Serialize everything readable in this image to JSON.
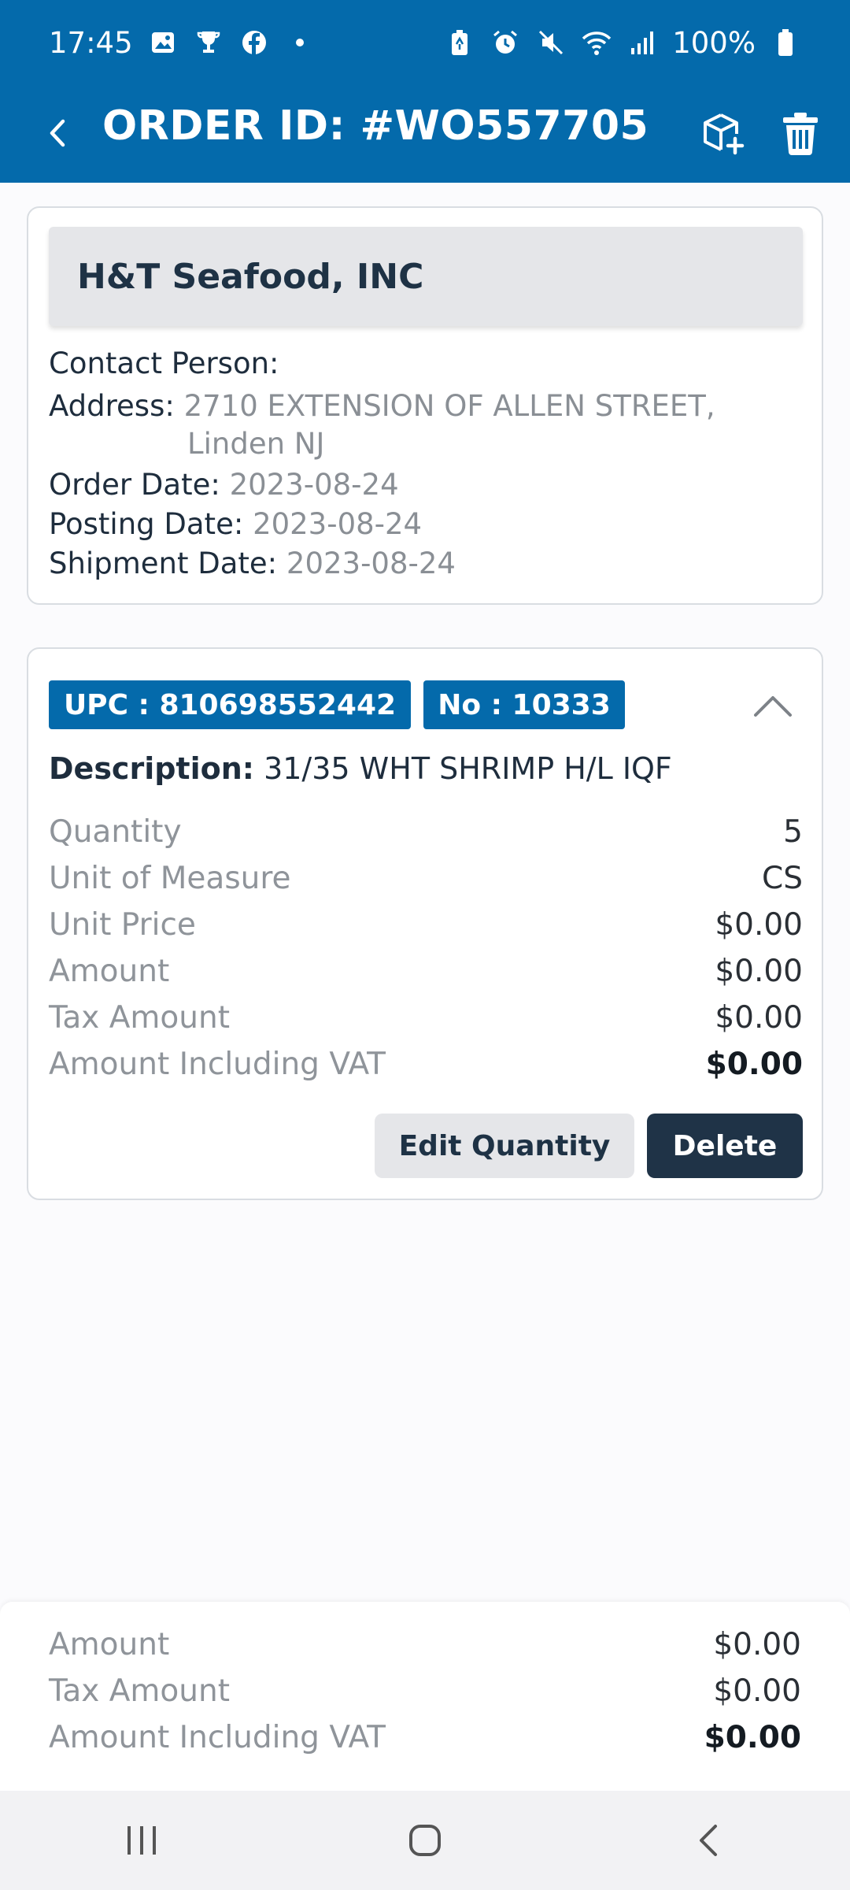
{
  "status_bar": {
    "time": "17:45",
    "battery": "100%",
    "left_icons": [
      "gallery-icon",
      "trophy-icon",
      "facebook-icon",
      "dot-icon"
    ],
    "right_icons": [
      "battery-saver-icon",
      "alarm-icon",
      "mute-icon",
      "wifi-icon",
      "signal-icon",
      "battery-icon"
    ]
  },
  "app_bar": {
    "title": "ORDER ID: #WO557705",
    "back_icon": "chevron-left-icon",
    "actions": [
      "add-box-icon",
      "trash-icon"
    ]
  },
  "order": {
    "company": "H&T Seafood, INC",
    "contact_label": "Contact Person:",
    "contact_value": "",
    "address_label": "Address:",
    "address_line1": "2710 EXTENSION OF ALLEN STREET,",
    "address_line2": "Linden NJ",
    "order_date_label": "Order Date:",
    "order_date": "2023-08-24",
    "posting_date_label": "Posting Date:",
    "posting_date": "2023-08-24",
    "shipment_date_label": "Shipment Date:",
    "shipment_date": "2023-08-24"
  },
  "line_item": {
    "upc_label": "UPC : 810698552442",
    "no_label": "No : 10333",
    "description_label": "Description:",
    "description": "31/35 WHT SHRIMP H/L IQF",
    "rows": [
      {
        "label": "Quantity",
        "value": "5"
      },
      {
        "label": "Unit of Measure",
        "value": "CS"
      },
      {
        "label": "Unit Price",
        "value": "$0.00"
      },
      {
        "label": "Amount",
        "value": "$0.00"
      },
      {
        "label": "Tax Amount",
        "value": "$0.00"
      },
      {
        "label": "Amount Including VAT",
        "value": "$0.00"
      }
    ],
    "edit_label": "Edit Quantity",
    "delete_label": "Delete"
  },
  "summary": {
    "rows": [
      {
        "label": "Amount",
        "value": "$0.00"
      },
      {
        "label": "Tax Amount",
        "value": "$0.00"
      },
      {
        "label": "Amount Including VAT",
        "value": "$0.00"
      }
    ]
  },
  "nav_bar": {
    "items": [
      "recent-apps-icon",
      "home-icon",
      "back-icon"
    ]
  },
  "colors": {
    "primary": "#046aab",
    "dark": "#1f3347",
    "muted": "#8f949a"
  }
}
